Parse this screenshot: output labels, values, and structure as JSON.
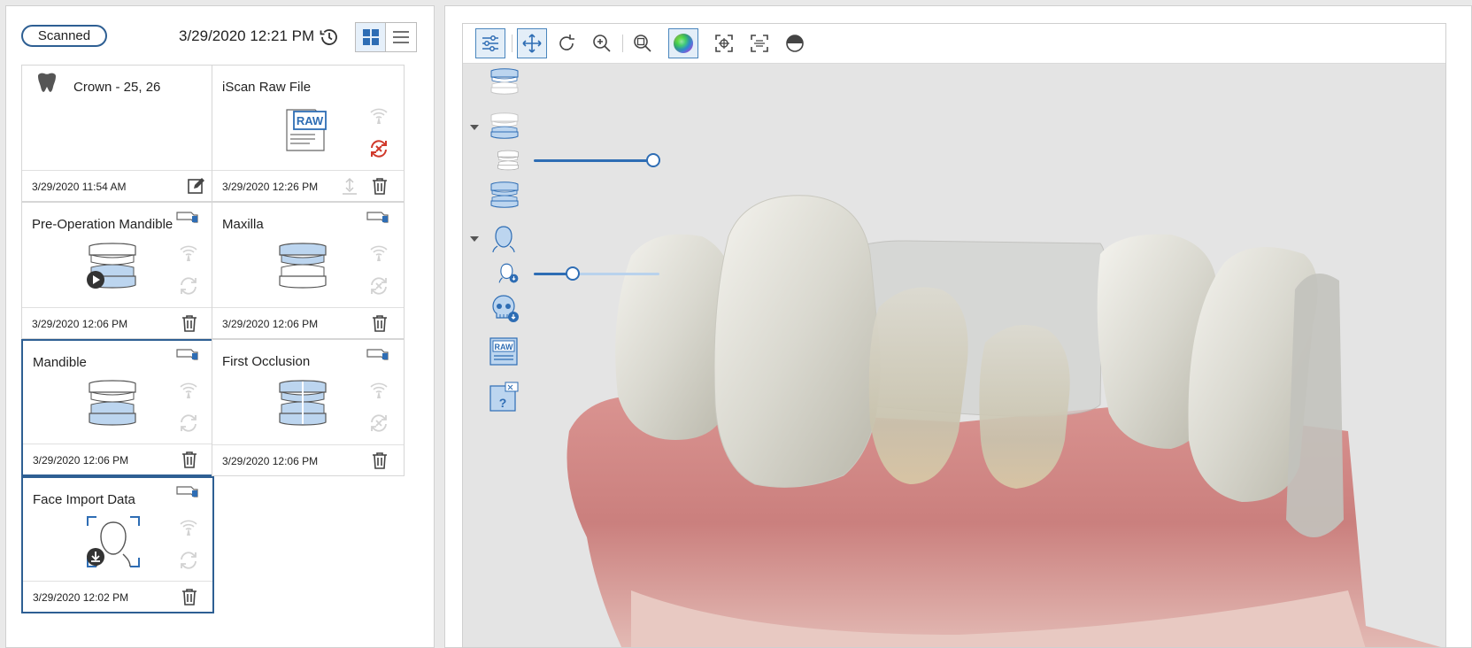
{
  "left_panel": {
    "status_label": "Scanned",
    "datetime": "3/29/2020 12:21 PM",
    "cards": [
      {
        "title": "Crown - 25, 26",
        "date": "3/29/2020 11:54 AM"
      },
      {
        "title": "iScan Raw File",
        "date": "3/29/2020 12:26 PM",
        "thumb_label": "RAW"
      },
      {
        "title": "Pre-Operation Mandible",
        "date": "3/29/2020 12:06 PM"
      },
      {
        "title": "Maxilla",
        "date": "3/29/2020 12:06 PM"
      },
      {
        "title": "Mandible",
        "date": "3/29/2020 12:06 PM"
      },
      {
        "title": "First Occlusion",
        "date": "3/29/2020 12:06 PM"
      },
      {
        "title": "Face Import Data",
        "date": "3/29/2020 12:02 PM"
      }
    ]
  },
  "viewer": {
    "layer_raw_label": "RAW",
    "layer_help_label": "?",
    "mandible_opacity": 1.0,
    "face_opacity": 0.31
  },
  "colors": {
    "accent": "#2e6db4",
    "selected_border": "#2e5f93",
    "error": "#d0392b",
    "tooth_blue": "#bcd5ef"
  }
}
